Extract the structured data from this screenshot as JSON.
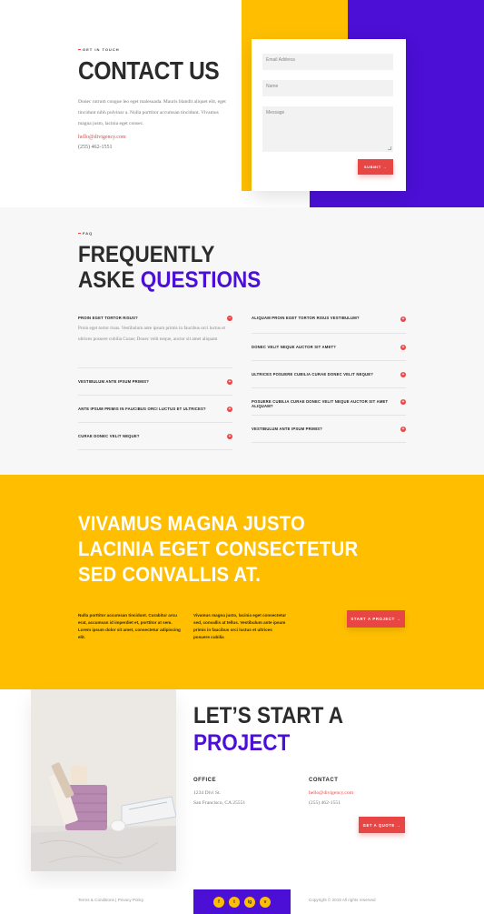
{
  "colors": {
    "yellow": "#ffbf00",
    "purple": "#4b0fd6",
    "red": "#e84545",
    "dark": "#2b2b2b"
  },
  "contact": {
    "eyebrow": "GET IN TOUCH",
    "title": "CONTACT US",
    "body": "Donec rutrum congue leo eget malesuada. Mauris blandit aliquet elit, eget tincidunt nibh pulvinar a. Nulla porttitor accumsan tincidunt. Vivamus magna justo, lacinia eget consec.",
    "email": "hello@divigency.com",
    "phone": "(255) 462-1551",
    "form": {
      "email_placeholder": "Email Address",
      "name_placeholder": "Name",
      "message_placeholder": "Message",
      "submit_label": "SUBMIT →"
    }
  },
  "faq": {
    "eyebrow": "FAQ",
    "title_line1": "FREQUENTLY",
    "title_line2_plain": "ASKE",
    "title_line2_accent": "QUESTIONS",
    "left": [
      {
        "q": "PROIN EGET TORTOR RISUS?",
        "a": "Proin eget tortor risus. Vestibulum ante ipsum primis in faucibus orci luctus et ultrices posuere cubilia Curae; Donec velit neque, auctor sit amet aliquam"
      },
      {
        "q": "VESTIBULUM ANTE IPSUM PRIMIS?"
      },
      {
        "q": "ANTE IPSUM PRIMIS IN FAUCIBUS ORCI LUCTUS ET ULTRICES?"
      },
      {
        "q": "CURAE DONEC VELIT NEQUE?"
      }
    ],
    "right": [
      {
        "q": "ALIQUAM PROIN EGET TORTOR RISUS VESTIBULUM?"
      },
      {
        "q": "DONEC VELIT NEQUE AUCTOR SIT AMET?"
      },
      {
        "q": "ULTRICES POSUERE CUBILIA CURAE DONEC VELIT NEQUE?"
      },
      {
        "q": "POSUERE CUBILIA CURAE DONEC VELIT NEQUE AUCTOR SIT AMET ALIQUAM?"
      },
      {
        "q": "VESTIBULUM ANTE IPSUM PRIMIS?"
      }
    ]
  },
  "cta": {
    "line1": "VIVAMUS MAGNA JUSTO",
    "line2": "LACINIA EGET CONSECTETUR",
    "line3": "SED CONVALLIS AT.",
    "col1": "Nulla porttitor accumsan tincidunt. Curabitur arcu erat, accumsan id imperdiet et, porttitor at sem. Lorem ipsum dolor sit amet, consectetur adipiscing elit.",
    "col2": "Vivamus magna justo, lacinia eget consectetur sed, convallis at tellus. Vestibulum ante ipsum primis in faucibus orci luctus et ultrices posuere cubilia",
    "button": "START A PROJECT →"
  },
  "project": {
    "title_line1": "LET’S START A",
    "title_line2": "PROJECT",
    "office_label": "OFFICE",
    "office_line1": "1234 Divi St.",
    "office_line2": "San Francisco, CA 25551",
    "contact_label": "CONTACT",
    "contact_email": "hello@divigency.com",
    "contact_phone": "(255) 462-1551",
    "button": "GET A QUOTE →"
  },
  "footer": {
    "terms": "Terms & Conditions",
    "sep": "|",
    "privacy": "Privacy Policy",
    "social": [
      "f",
      "t",
      "ig",
      "v"
    ],
    "copyright": "Copyright © 2019 All rights reserved"
  }
}
